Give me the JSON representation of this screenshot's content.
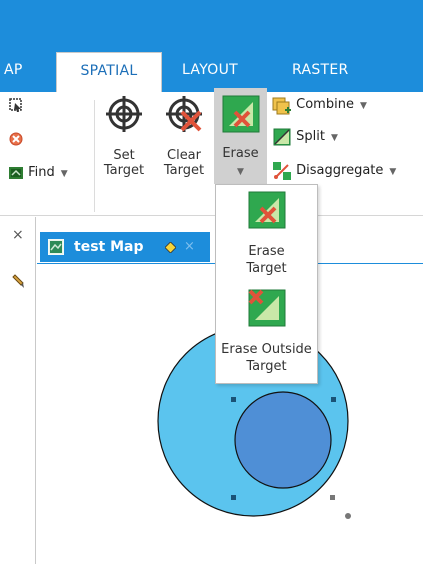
{
  "ribbon": {
    "tabs": [
      {
        "label": "AP"
      },
      {
        "label": "SPATIAL"
      },
      {
        "label": "LAYOUT"
      },
      {
        "label": "RASTER"
      }
    ],
    "find_label": "Find",
    "set_target": {
      "line1": "Set",
      "line2": "Target"
    },
    "clear_target": {
      "line1": "Clear",
      "line2": "Target"
    },
    "erase": {
      "label": "Erase"
    },
    "combine_label": "Combine",
    "split_label": "Split",
    "disaggregate_label": "Disaggregate"
  },
  "erase_menu": {
    "erase_target": {
      "line1": "Erase",
      "line2": "Target"
    },
    "erase_outside_target": {
      "line1": "Erase Outside",
      "line2": "Target"
    }
  },
  "map": {
    "tab_title": "test Map",
    "close_glyph": "×",
    "left_close_glyph": "×"
  },
  "colors": {
    "accent_blue": "#1d8ddb",
    "outer_circle": "#5bc4ee",
    "inner_circle": "#4f8fd6",
    "erase_highlight": "#d0d0d0"
  }
}
